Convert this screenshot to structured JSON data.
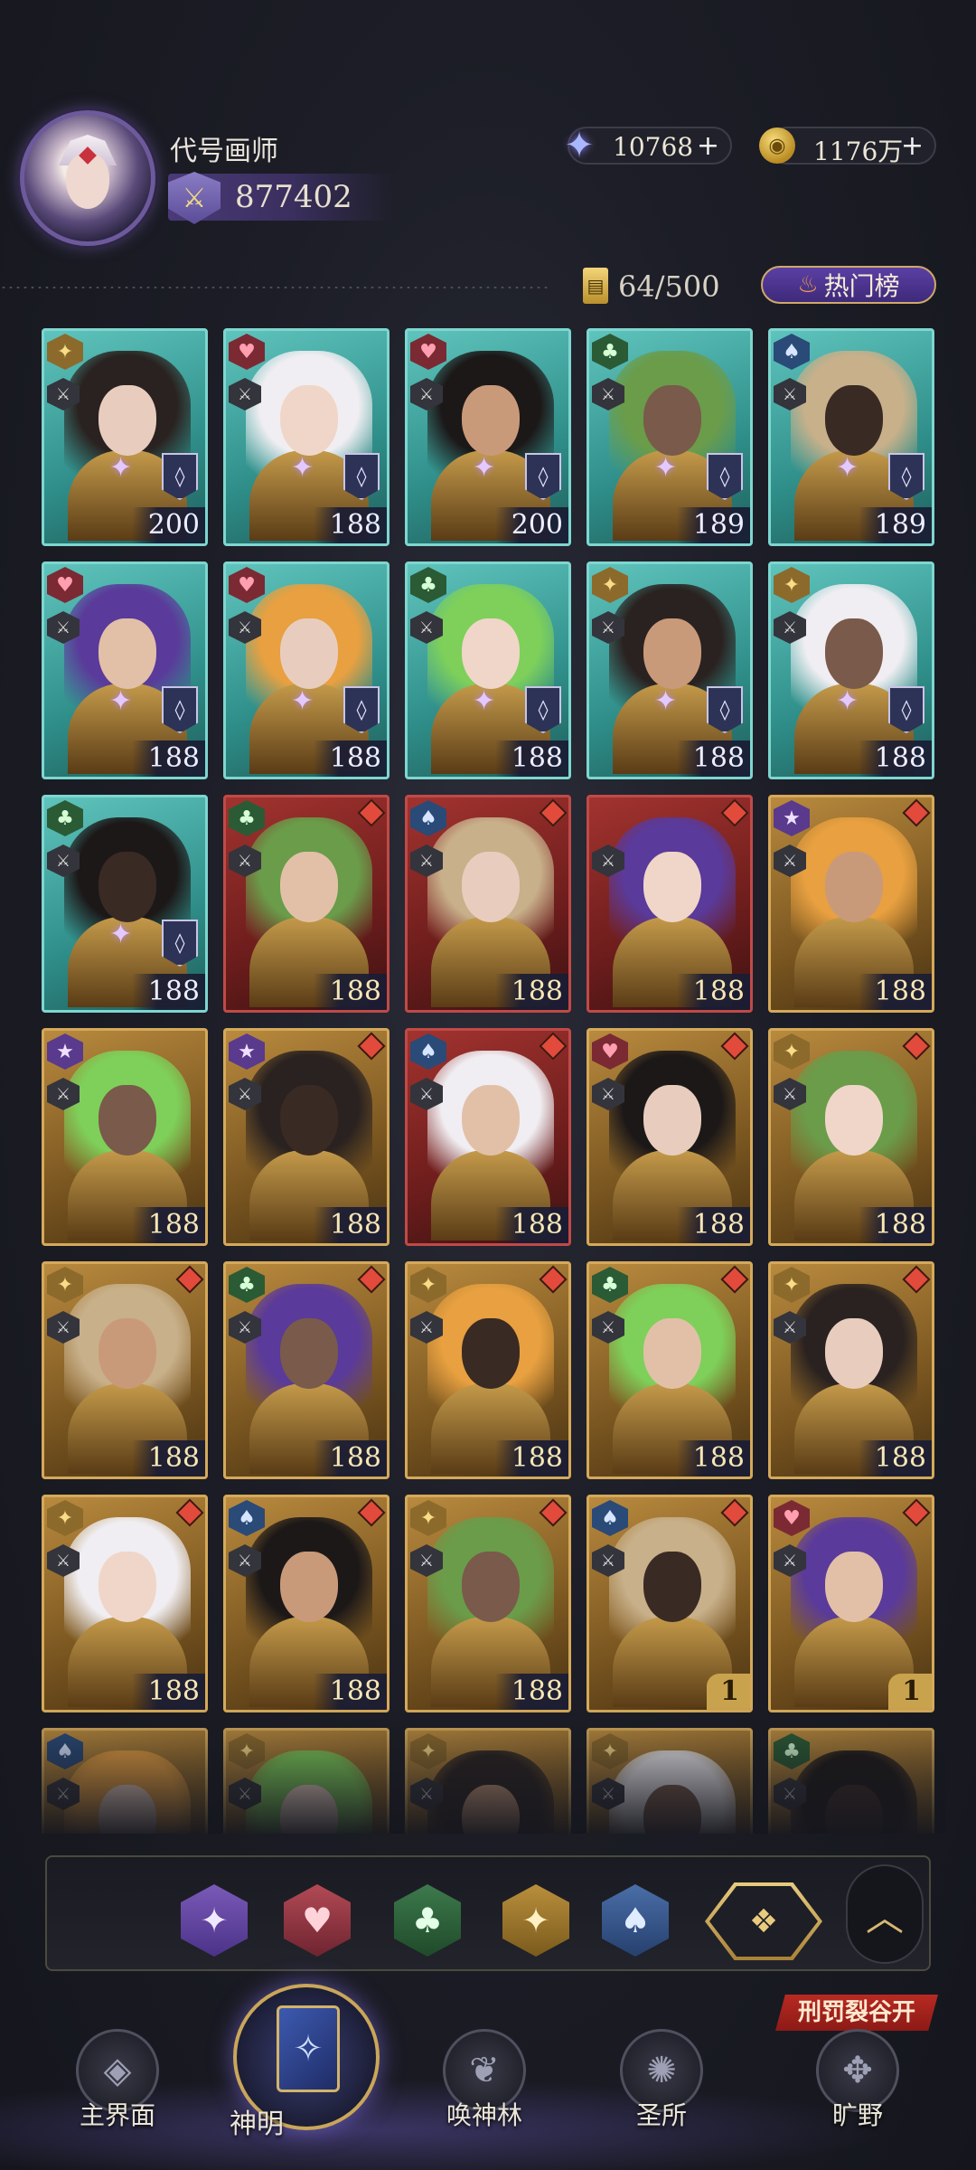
{
  "header": {
    "player_name": "代号画师",
    "power": "877402",
    "star_currency": "10768",
    "gold_currency": "1176万",
    "plus_symbol": "+"
  },
  "roster": {
    "capacity": "64/500",
    "hot_button": "热门榜"
  },
  "cards": [
    {
      "frame": "teal",
      "suit": "diamond",
      "level": "200",
      "rank_badge": true,
      "red_mark": false
    },
    {
      "frame": "teal",
      "suit": "heart",
      "level": "188",
      "rank_badge": true,
      "red_mark": false
    },
    {
      "frame": "teal",
      "suit": "heart",
      "level": "200",
      "rank_badge": true,
      "red_mark": false
    },
    {
      "frame": "teal",
      "suit": "club",
      "level": "189",
      "rank_badge": true,
      "red_mark": false
    },
    {
      "frame": "teal",
      "suit": "spade",
      "level": "189",
      "rank_badge": true,
      "red_mark": false
    },
    {
      "frame": "teal",
      "suit": "heart",
      "level": "188",
      "rank_badge": true,
      "red_mark": false
    },
    {
      "frame": "teal",
      "suit": "heart",
      "level": "188",
      "rank_badge": true,
      "red_mark": false
    },
    {
      "frame": "teal",
      "suit": "club",
      "level": "188",
      "rank_badge": true,
      "red_mark": false
    },
    {
      "frame": "teal",
      "suit": "diamond",
      "level": "188",
      "rank_badge": true,
      "red_mark": false
    },
    {
      "frame": "teal",
      "suit": "diamond",
      "level": "188",
      "rank_badge": true,
      "red_mark": false
    },
    {
      "frame": "teal",
      "suit": "club",
      "level": "188",
      "rank_badge": true,
      "red_mark": false
    },
    {
      "frame": "red",
      "suit": "club",
      "level": "188",
      "rank_badge": false,
      "red_mark": true
    },
    {
      "frame": "red",
      "suit": "spade",
      "level": "188",
      "rank_badge": false,
      "red_mark": true
    },
    {
      "frame": "red",
      "suit": "none",
      "level": "188",
      "rank_badge": false,
      "red_mark": true
    },
    {
      "frame": "gold",
      "suit": "star",
      "level": "188",
      "rank_badge": false,
      "red_mark": true
    },
    {
      "frame": "gold",
      "suit": "star",
      "level": "188",
      "rank_badge": false,
      "red_mark": false
    },
    {
      "frame": "gold",
      "suit": "star",
      "level": "188",
      "rank_badge": false,
      "red_mark": true
    },
    {
      "frame": "red",
      "suit": "spade",
      "level": "188",
      "rank_badge": false,
      "red_mark": true
    },
    {
      "frame": "gold",
      "suit": "heart",
      "level": "188",
      "rank_badge": false,
      "red_mark": true
    },
    {
      "frame": "gold",
      "suit": "diamond",
      "level": "188",
      "rank_badge": false,
      "red_mark": true
    },
    {
      "frame": "gold",
      "suit": "diamond",
      "level": "188",
      "rank_badge": false,
      "red_mark": true
    },
    {
      "frame": "gold",
      "suit": "club",
      "level": "188",
      "rank_badge": false,
      "red_mark": true
    },
    {
      "frame": "gold",
      "suit": "diamond",
      "level": "188",
      "rank_badge": false,
      "red_mark": true
    },
    {
      "frame": "gold",
      "suit": "club",
      "level": "188",
      "rank_badge": false,
      "red_mark": true
    },
    {
      "frame": "gold",
      "suit": "diamond",
      "level": "188",
      "rank_badge": false,
      "red_mark": true
    },
    {
      "frame": "gold",
      "suit": "diamond",
      "level": "188",
      "rank_badge": false,
      "red_mark": true
    },
    {
      "frame": "gold",
      "suit": "spade",
      "level": "188",
      "rank_badge": false,
      "red_mark": true
    },
    {
      "frame": "gold",
      "suit": "diamond",
      "level": "188",
      "rank_badge": false,
      "red_mark": true
    },
    {
      "frame": "gold",
      "suit": "spade",
      "level": "1",
      "rank_badge": false,
      "red_mark": true
    },
    {
      "frame": "gold",
      "suit": "heart",
      "level": "1",
      "rank_badge": false,
      "red_mark": true
    },
    {
      "frame": "gold",
      "suit": "spade",
      "level": "",
      "rank_badge": false,
      "red_mark": false
    },
    {
      "frame": "gold",
      "suit": "diamond",
      "level": "",
      "rank_badge": false,
      "red_mark": false
    },
    {
      "frame": "gold",
      "suit": "diamond",
      "level": "",
      "rank_badge": false,
      "red_mark": false
    },
    {
      "frame": "gold",
      "suit": "diamond",
      "level": "",
      "rank_badge": false,
      "red_mark": false
    },
    {
      "frame": "gold",
      "suit": "club",
      "level": "",
      "rank_badge": false,
      "red_mark": false
    }
  ],
  "filters": {
    "star": "✦",
    "heart": "♥",
    "club": "♣",
    "diamond": "✦",
    "spade": "♠",
    "all": "❖",
    "collapse": "︿"
  },
  "nav": {
    "event_banner": "刑罚裂谷开启！",
    "items": [
      {
        "label": "主界面"
      },
      {
        "label": "神明"
      },
      {
        "label": "唤神林"
      },
      {
        "label": "圣所"
      },
      {
        "label": "旷野"
      }
    ]
  },
  "colors": {
    "frame_teal": "#5fc4bd",
    "frame_red": "#a2332f",
    "frame_gold": "#b98a3e",
    "accent_gold": "#d5a95a"
  }
}
